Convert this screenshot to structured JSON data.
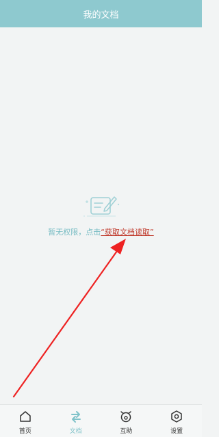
{
  "header": {
    "title": "我的文档"
  },
  "empty_state": {
    "icon": "document-edit-icon",
    "message": "暂无权限，点击",
    "link_text": "“获取文档读取”"
  },
  "tabbar": {
    "active": "文档",
    "items": [
      {
        "label": "首页",
        "icon": "home-icon"
      },
      {
        "label": "文档",
        "icon": "swap-arrows-icon"
      },
      {
        "label": "互助",
        "icon": "mutual-aid-icon"
      },
      {
        "label": "设置",
        "icon": "settings-hexagon-icon"
      }
    ]
  },
  "colors": {
    "header_bg": "#8ec9cf",
    "accent": "#7fc2c9",
    "link": "#c0392b",
    "annotation_arrow": "#ee2222"
  }
}
